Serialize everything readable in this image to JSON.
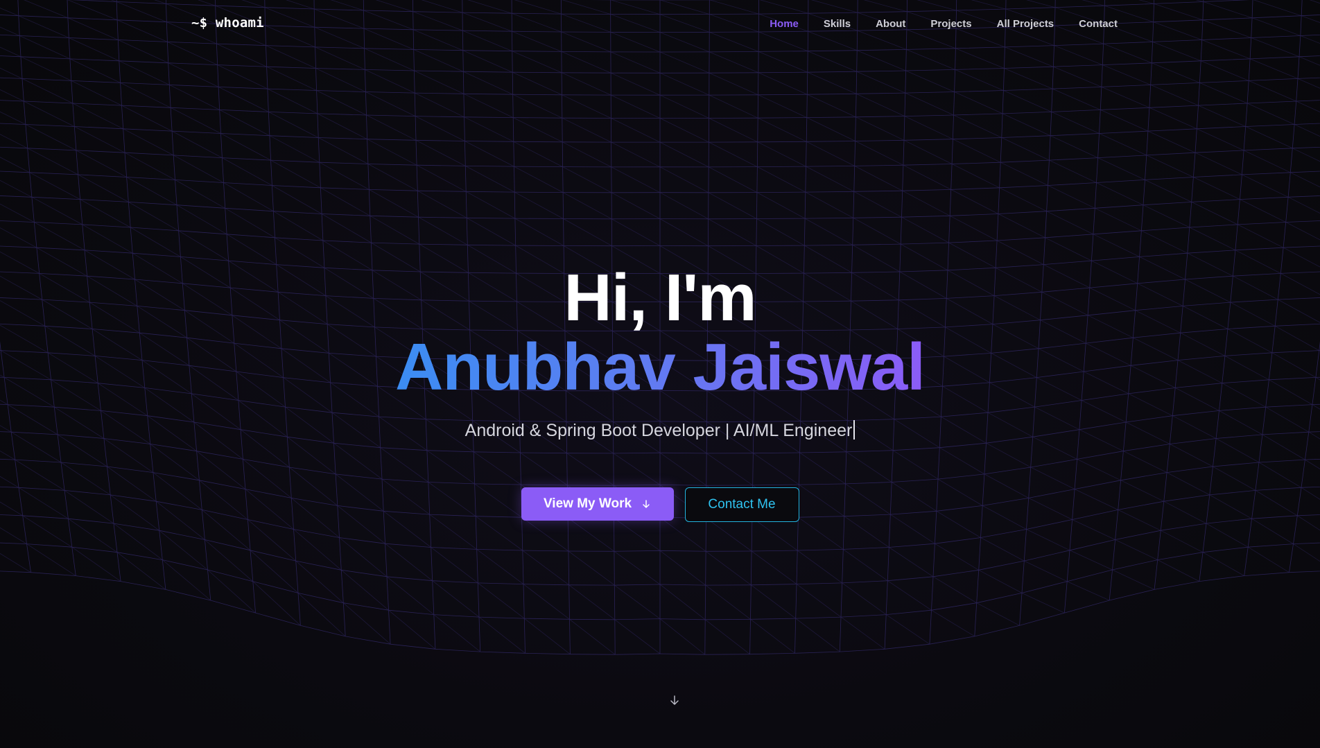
{
  "nav": {
    "logo": "~$ whoami",
    "links": [
      {
        "label": "Home",
        "active": true
      },
      {
        "label": "Skills",
        "active": false
      },
      {
        "label": "About",
        "active": false
      },
      {
        "label": "Projects",
        "active": false
      },
      {
        "label": "All Projects",
        "active": false
      },
      {
        "label": "Contact",
        "active": false
      }
    ]
  },
  "hero": {
    "greeting": "Hi, I'm",
    "name": "Anubhav Jaiswal",
    "subtitle": "Android & Spring Boot Developer | AI/ML Engineer",
    "primary_button": {
      "label": "View My Work",
      "icon": "arrow-down-icon"
    },
    "secondary_button": {
      "label": "Contact Me"
    },
    "scroll_icon": "arrow-down-icon"
  },
  "colors": {
    "background": "#0a0a0e",
    "accent_purple": "#8b5cf6",
    "accent_blue": "#3b8df2",
    "accent_cyan": "#22b4e0",
    "mesh_line": "#3a2f7a"
  }
}
